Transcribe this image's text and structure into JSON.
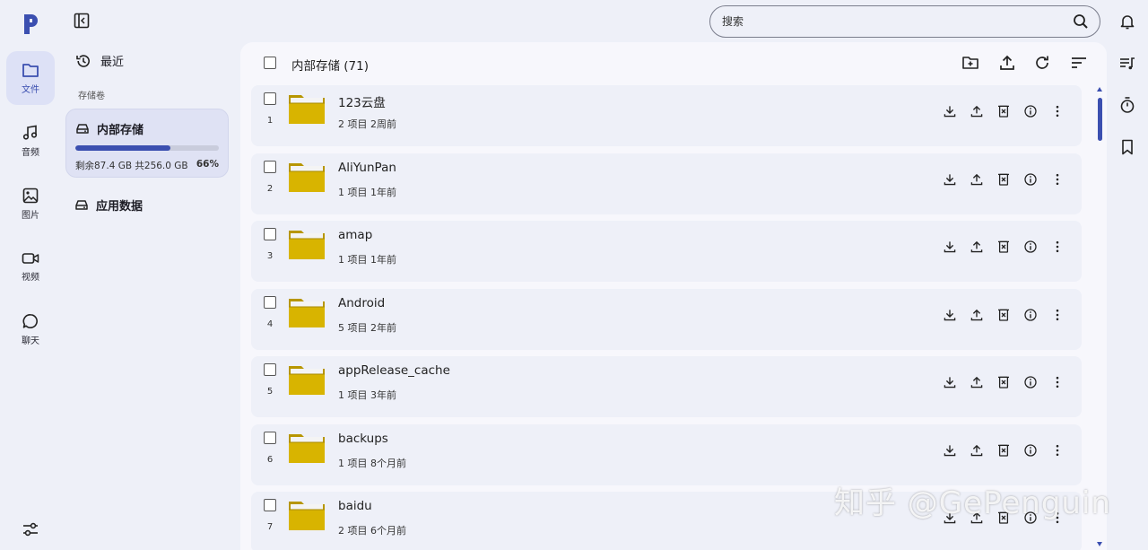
{
  "rail": {
    "items": [
      {
        "label": "文件",
        "icon": "folder-icon",
        "active": true
      },
      {
        "label": "音频",
        "icon": "music-note-icon",
        "active": false
      },
      {
        "label": "图片",
        "icon": "image-icon",
        "active": false
      },
      {
        "label": "视频",
        "icon": "video-camera-icon",
        "active": false
      },
      {
        "label": "聊天",
        "icon": "chat-bubble-icon",
        "active": false
      }
    ]
  },
  "side": {
    "recent_label": "最近",
    "section_label": "存储卷",
    "storage": {
      "title": "内部存储",
      "free_text": "剩余87.4 GB 共256.0 GB",
      "percent_text": "66%",
      "used_fraction": 0.66
    },
    "appdata_label": "应用数据"
  },
  "search": {
    "placeholder": "搜索"
  },
  "main": {
    "title": "内部存储 (71)",
    "rows": [
      {
        "index": "1",
        "name": "123云盘",
        "meta": "2 项目  2周前"
      },
      {
        "index": "2",
        "name": "AliYunPan",
        "meta": "1 项目  1年前"
      },
      {
        "index": "3",
        "name": "amap",
        "meta": "1 项目  1年前"
      },
      {
        "index": "4",
        "name": "Android",
        "meta": "5 项目  2年前"
      },
      {
        "index": "5",
        "name": "appRelease_cache",
        "meta": "1 项目  3年前"
      },
      {
        "index": "6",
        "name": "backups",
        "meta": "1 项目  8个月前"
      },
      {
        "index": "7",
        "name": "baidu",
        "meta": "2 项目  6个月前"
      }
    ]
  },
  "watermark": "知乎 @GePenguin",
  "colors": {
    "accent": "#3b4fb0",
    "folder": "#d8b400",
    "folder_tab": "#f4f4f4"
  }
}
